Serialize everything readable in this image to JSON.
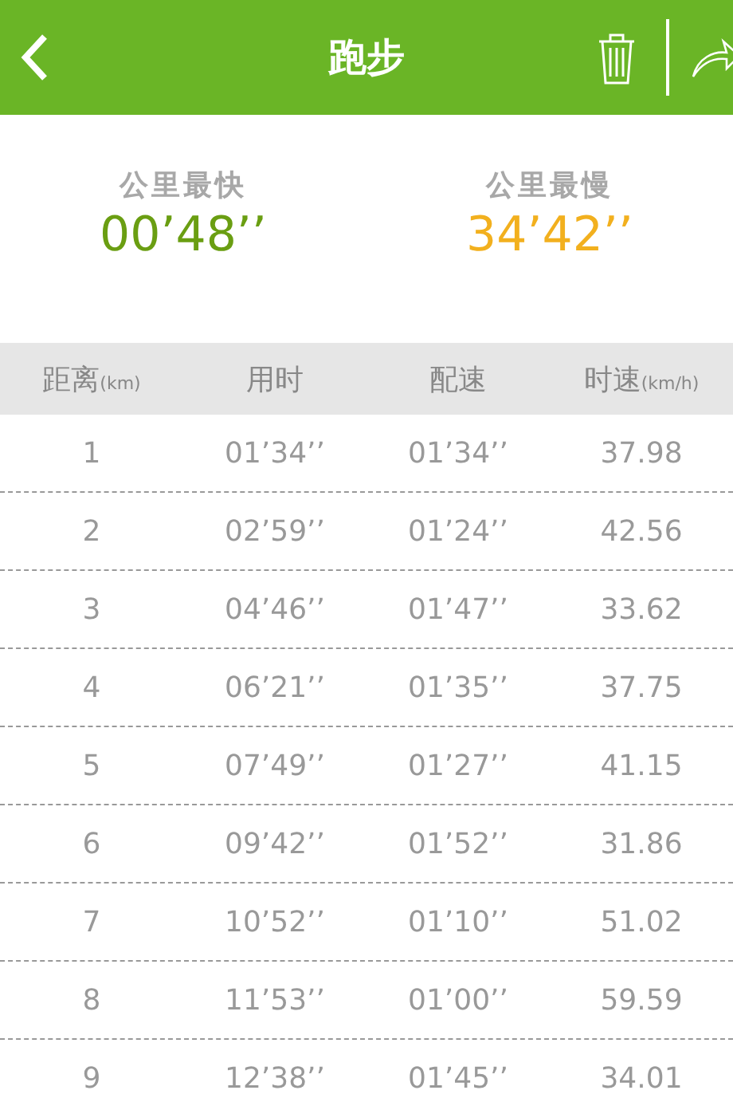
{
  "header": {
    "title": "跑步"
  },
  "stats": [
    {
      "label": "公里最快",
      "value": "00’48’’",
      "color": "#6a9e12"
    },
    {
      "label": "公里最慢",
      "value": "34’42’’",
      "color": "#f2b01e"
    }
  ],
  "table": {
    "columns": [
      {
        "label": "距离",
        "unit": "(km)"
      },
      {
        "label": "用时"
      },
      {
        "label": "配速"
      },
      {
        "label": "时速",
        "unit": "(km/h)"
      }
    ],
    "rows": [
      [
        "1",
        "01’34’’",
        "01’34’’",
        "37.98"
      ],
      [
        "2",
        "02’59’’",
        "01’24’’",
        "42.56"
      ],
      [
        "3",
        "04’46’’",
        "01’47’’",
        "33.62"
      ],
      [
        "4",
        "06’21’’",
        "01’35’’",
        "37.75"
      ],
      [
        "5",
        "07’49’’",
        "01’27’’",
        "41.15"
      ],
      [
        "6",
        "09’42’’",
        "01’52’’",
        "31.86"
      ],
      [
        "7",
        "10’52’’",
        "01’10’’",
        "51.02"
      ],
      [
        "8",
        "11’53’’",
        "01’00’’",
        "59.59"
      ],
      [
        "9",
        "12’38’’",
        "01’45’’",
        "34.01"
      ]
    ]
  }
}
